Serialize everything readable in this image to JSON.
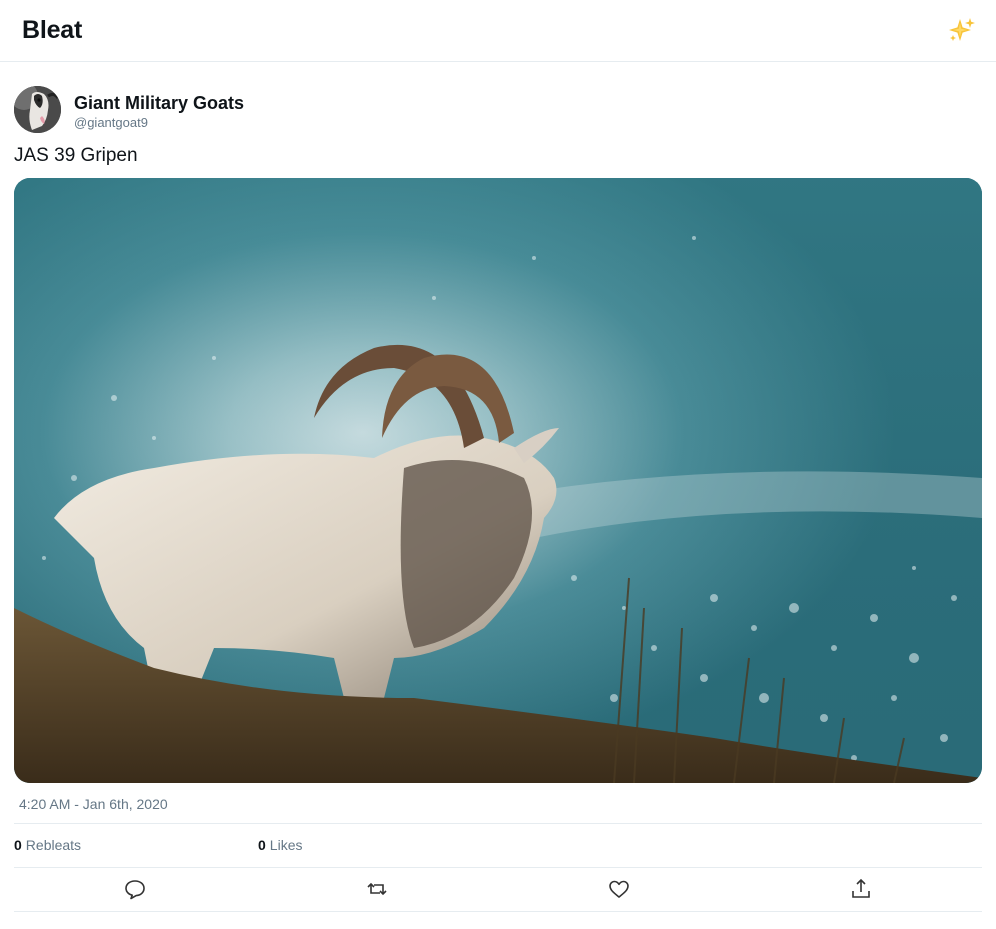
{
  "app": {
    "title": "Bleat",
    "sparkle_icon": "sparkles-icon"
  },
  "tweet": {
    "author": {
      "name": "Giant Military Goats",
      "handle": "@giantgoat9",
      "avatar_icon": "goat-avatar"
    },
    "text": "JAS 39 Gripen",
    "media_subject": "goat-photo",
    "timestamp": "4:20 AM - Jan 6th, 2020",
    "stats": {
      "rebleats_count": "0",
      "rebleats_label": "Rebleats",
      "likes_count": "0",
      "likes_label": "Likes"
    },
    "actions": [
      "reply-icon",
      "rebleat-icon",
      "like-icon",
      "share-icon"
    ]
  },
  "colors": {
    "text": "#0f1419",
    "muted": "#657786",
    "border": "#e6ecf0",
    "sparkle": "#f4b400"
  }
}
